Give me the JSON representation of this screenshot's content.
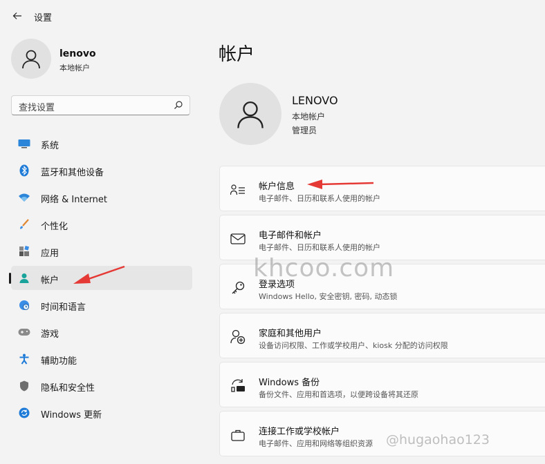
{
  "app": {
    "title": "设置"
  },
  "user": {
    "name": "lenovo",
    "type": "本地帐户"
  },
  "search": {
    "placeholder": "查找设置"
  },
  "sidebar": {
    "items": [
      {
        "label": "系统",
        "icon": "system-icon"
      },
      {
        "label": "蓝牙和其他设备",
        "icon": "bluetooth-icon"
      },
      {
        "label": "网络 & Internet",
        "icon": "wifi-icon"
      },
      {
        "label": "个性化",
        "icon": "brush-icon"
      },
      {
        "label": "应用",
        "icon": "apps-icon"
      },
      {
        "label": "帐户",
        "icon": "person-icon",
        "active": true
      },
      {
        "label": "时间和语言",
        "icon": "globe-clock-icon"
      },
      {
        "label": "游戏",
        "icon": "gamepad-icon"
      },
      {
        "label": "辅助功能",
        "icon": "accessibility-icon"
      },
      {
        "label": "隐私和安全性",
        "icon": "shield-icon"
      },
      {
        "label": "Windows 更新",
        "icon": "update-icon"
      }
    ]
  },
  "main": {
    "title": "帐户",
    "account": {
      "name": "LENOVO",
      "type": "本地帐户",
      "role": "管理员"
    },
    "cards": [
      {
        "title": "帐户信息",
        "subtitle": "电子邮件、日历和联系人使用的帐户",
        "icon": "account-info-icon"
      },
      {
        "title": "电子邮件和帐户",
        "subtitle": "电子邮件、日历和联系人使用的帐户",
        "icon": "mail-icon"
      },
      {
        "title": "登录选项",
        "subtitle": "Windows Hello, 安全密钥, 密码, 动态锁",
        "icon": "key-icon"
      },
      {
        "title": "家庭和其他用户",
        "subtitle": "设备访问权限、工作或学校用户、kiosk 分配的访问权限",
        "icon": "family-icon"
      },
      {
        "title": "Windows 备份",
        "subtitle": "备份文件、应用和首选项，以便跨设备将其还原",
        "icon": "backup-icon"
      },
      {
        "title": "连接工作或学校帐户",
        "subtitle": "电子邮件、应用和网络等组织资源",
        "icon": "briefcase-icon"
      }
    ]
  },
  "watermarks": {
    "site": "khcoo.com",
    "author": "@hugaohao123"
  },
  "colors": {
    "accent": "#0067c0",
    "arrow": "#e53935",
    "background": "#f3f3f3"
  }
}
